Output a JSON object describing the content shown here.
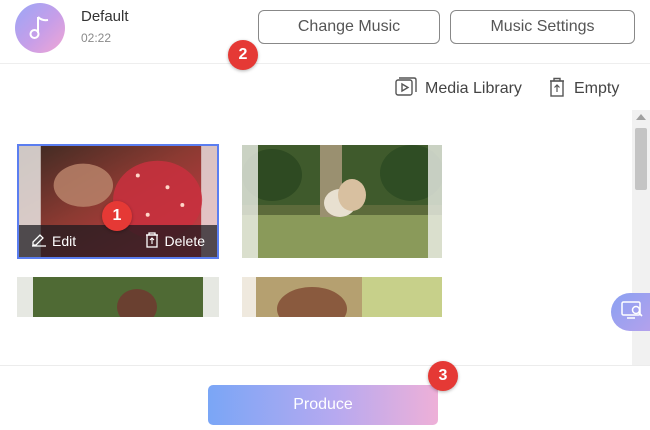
{
  "header": {
    "music_title": "Default",
    "music_duration": "02:22",
    "change_music_label": "Change Music",
    "music_settings_label": "Music Settings"
  },
  "toolbar": {
    "media_library_label": "Media Library",
    "empty_label": "Empty"
  },
  "thumbnails": [
    {
      "selected": true,
      "edit_label": "Edit",
      "delete_label": "Delete"
    },
    {
      "selected": false
    },
    {
      "selected": false
    },
    {
      "selected": false
    }
  ],
  "footer": {
    "produce_label": "Produce"
  },
  "callouts": [
    "1",
    "2",
    "3"
  ],
  "colors": {
    "accent": "#5b7ef0",
    "badge": "#e53935",
    "produce_gradient_start": "#7aa6f6",
    "produce_gradient_end": "#eeb0d8"
  }
}
